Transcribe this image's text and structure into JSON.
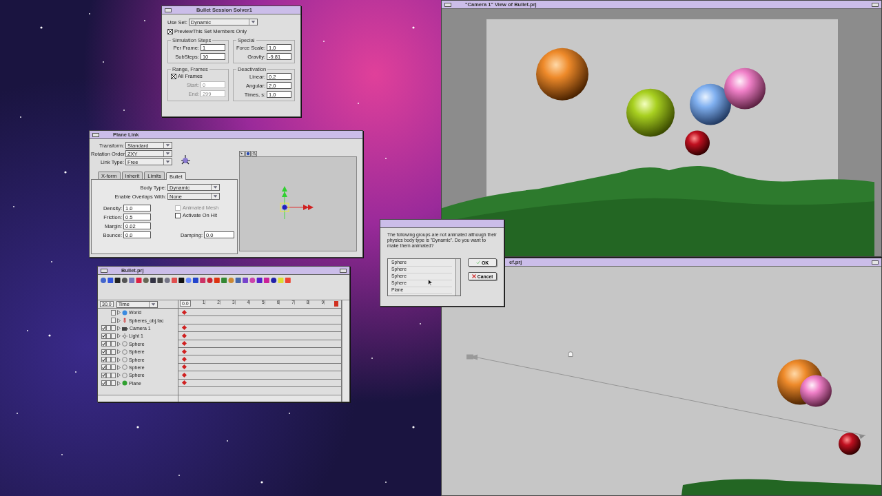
{
  "solver_window": {
    "title": "Bullet Session Solver1",
    "use_set": {
      "label": "Use Set:",
      "value": "Dynamic"
    },
    "preview_only": {
      "label": "PreviewThis Set Members Only",
      "checked": true
    },
    "groups": [
      {
        "title": "Simulation Steps",
        "fields": [
          {
            "label": "Per Frame:",
            "value": "1",
            "disabled": false
          },
          {
            "label": "SubSteps:",
            "value": "10",
            "disabled": false
          }
        ]
      },
      {
        "title": "Special",
        "fields": [
          {
            "label": "Force Scale:",
            "value": "1.0",
            "disabled": false
          },
          {
            "label": "Gravity:",
            "value": "-9.81",
            "disabled": false
          }
        ]
      },
      {
        "title": "Range, Frames",
        "all_frames": {
          "label": "All Frames",
          "checked": true
        },
        "fields": [
          {
            "label": "Start:",
            "value": "0",
            "disabled": true
          },
          {
            "label": "End:",
            "value": "299",
            "disabled": true
          }
        ]
      },
      {
        "title": "Deactivation",
        "fields": [
          {
            "label": "Linear:",
            "value": "0.2",
            "disabled": false
          },
          {
            "label": "Angular:",
            "value": "2.0",
            "disabled": false
          },
          {
            "label": "Times, s:",
            "value": "1.0",
            "disabled": false
          }
        ]
      }
    ]
  },
  "link_window": {
    "title": "Plane Link",
    "selects": [
      {
        "label": "Transform:",
        "value": "Standard"
      },
      {
        "label": "Rotation Order:",
        "value": "ZXY"
      },
      {
        "label": "Link Type:",
        "value": "Free"
      }
    ],
    "tabs": [
      {
        "label": "X-form",
        "selected": false
      },
      {
        "label": "Inherit",
        "selected": false
      },
      {
        "label": "Limits",
        "selected": false
      },
      {
        "label": "Bullet",
        "selected": true
      }
    ],
    "bullet": {
      "selects": [
        {
          "label": "Body Type:",
          "value": "Dynamic"
        },
        {
          "label": "Enable Overlaps With:",
          "value": "None"
        }
      ],
      "fields": [
        {
          "label": "Density:",
          "value": "1.0"
        },
        {
          "label": "Friction:",
          "value": "0.5"
        },
        {
          "label": "Margin:",
          "value": "0.02"
        },
        {
          "label": "Bounce:",
          "value": "0.0"
        }
      ],
      "checkboxes": [
        {
          "label": "Animated Mesh",
          "checked": false,
          "disabled": true
        },
        {
          "label": "Activate On Hit",
          "checked": false,
          "disabled": false
        }
      ],
      "damping": {
        "label": "Damping:",
        "value": "0.0"
      }
    }
  },
  "timeline_window": {
    "title": "Bullet.prj",
    "frame_rate": "30.0",
    "column_menu": "Time",
    "start_time": "0.0",
    "ticks": [
      "1",
      "2",
      "3",
      "4",
      "5",
      "6",
      "7",
      "8",
      "9"
    ],
    "rows": [
      {
        "name": "World",
        "kind": "world",
        "locks": false,
        "checked": false,
        "keyframe": true
      },
      {
        "name": "Spheres_obj.fac",
        "kind": "figure",
        "locks": false,
        "checked": false,
        "keyframe": false
      },
      {
        "name": "Camera 1",
        "kind": "camera",
        "locks": true,
        "checked": true,
        "keyframe": true
      },
      {
        "name": "Light 1",
        "kind": "light",
        "locks": true,
        "checked": true,
        "keyframe": true
      },
      {
        "name": "Sphere",
        "kind": "sphere",
        "locks": true,
        "checked": true,
        "keyframe": true
      },
      {
        "name": "Sphere",
        "kind": "sphere",
        "locks": true,
        "checked": true,
        "keyframe": true
      },
      {
        "name": "Sphere",
        "kind": "sphere",
        "locks": true,
        "checked": true,
        "keyframe": true
      },
      {
        "name": "Sphere",
        "kind": "sphere",
        "locks": true,
        "checked": true,
        "keyframe": true
      },
      {
        "name": "Sphere",
        "kind": "sphere",
        "locks": true,
        "checked": true,
        "keyframe": true
      },
      {
        "name": "Plane",
        "kind": "plane",
        "locks": true,
        "checked": true,
        "keyframe": true
      }
    ]
  },
  "dialog": {
    "message": "The following groups are not animated although their physics body type is \"Dynamic\". Do you want to make them animated?",
    "items": [
      "Sphere",
      "Sphere",
      "Sphere",
      "Sphere",
      "Plane"
    ],
    "buttons": [
      {
        "label": "OK",
        "kind": "ok"
      },
      {
        "label": "Cancel",
        "kind": "cancel"
      }
    ]
  },
  "views": [
    {
      "title": "\"Camera 1\" View of Bullet.prj",
      "kind": "camera"
    },
    {
      "title": "ef.prj",
      "kind": "top"
    }
  ]
}
